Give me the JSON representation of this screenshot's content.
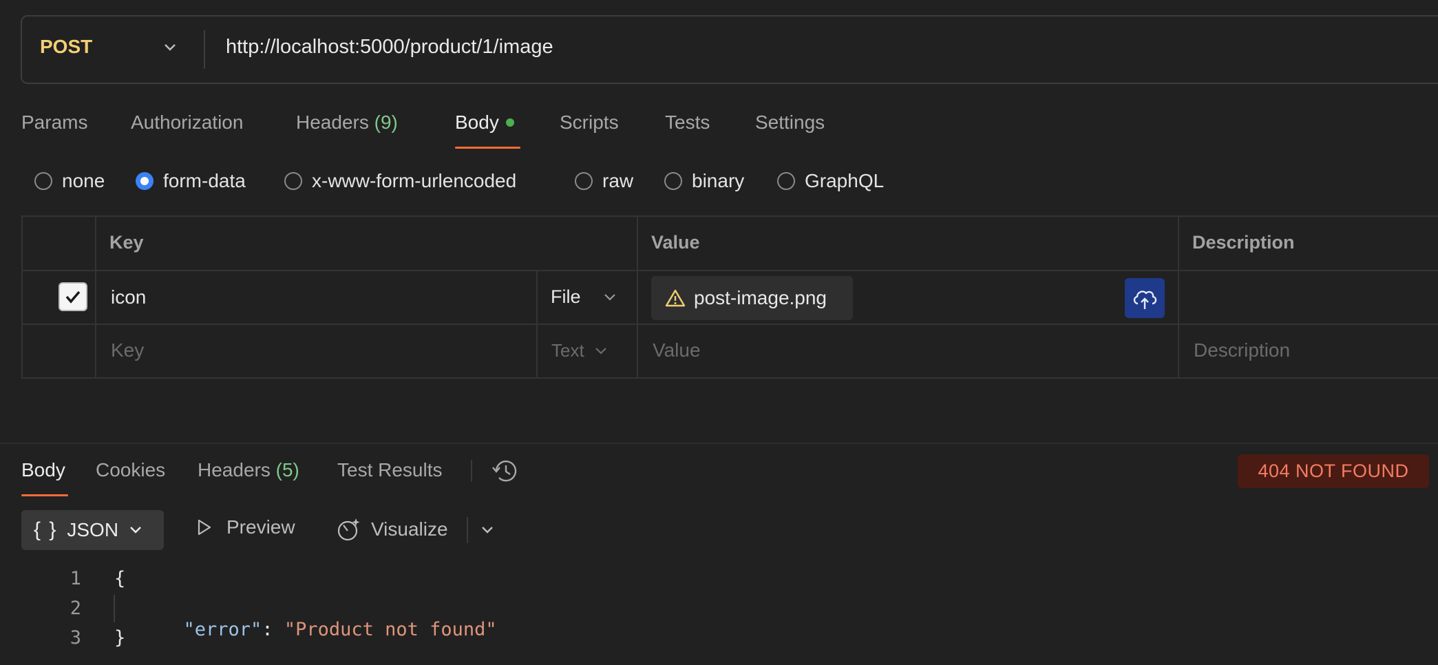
{
  "request": {
    "method": "POST",
    "url": "http://localhost:5000/product/1/image"
  },
  "request_tabs": {
    "params": "Params",
    "authorization": "Authorization",
    "headers": "Headers",
    "headers_count": "(9)",
    "body": "Body",
    "scripts": "Scripts",
    "tests": "Tests",
    "settings": "Settings"
  },
  "body_types": {
    "none": "none",
    "form_data": "form-data",
    "urlencoded": "x-www-form-urlencoded",
    "raw": "raw",
    "binary": "binary",
    "graphql": "GraphQL",
    "selected": "form-data"
  },
  "form_table": {
    "headers": {
      "key": "Key",
      "value": "Value",
      "description": "Description"
    },
    "rows": [
      {
        "checked": true,
        "key": "icon",
        "type": "File",
        "value": "post-image.png"
      }
    ],
    "empty_row": {
      "key_placeholder": "Key",
      "type": "Text",
      "value_placeholder": "Value",
      "description_placeholder": "Description"
    }
  },
  "response": {
    "tabs": {
      "body": "Body",
      "cookies": "Cookies",
      "headers": "Headers",
      "headers_count": "(5)",
      "test_results": "Test Results"
    },
    "status": "404 NOT FOUND",
    "format": "JSON",
    "preview": "Preview",
    "visualize": "Visualize",
    "code": {
      "line_numbers": [
        "1",
        "2",
        "3"
      ],
      "open_brace": "{",
      "key": "\"error\"",
      "colon": ": ",
      "value": "\"Product not found\"",
      "close_brace": "}"
    }
  },
  "colors": {
    "method": "#f2cf74",
    "accent": "#ff6c37",
    "status_bg": "#4a1b12",
    "status_text": "#f47c63",
    "upload_button": "#1f3a8a"
  }
}
